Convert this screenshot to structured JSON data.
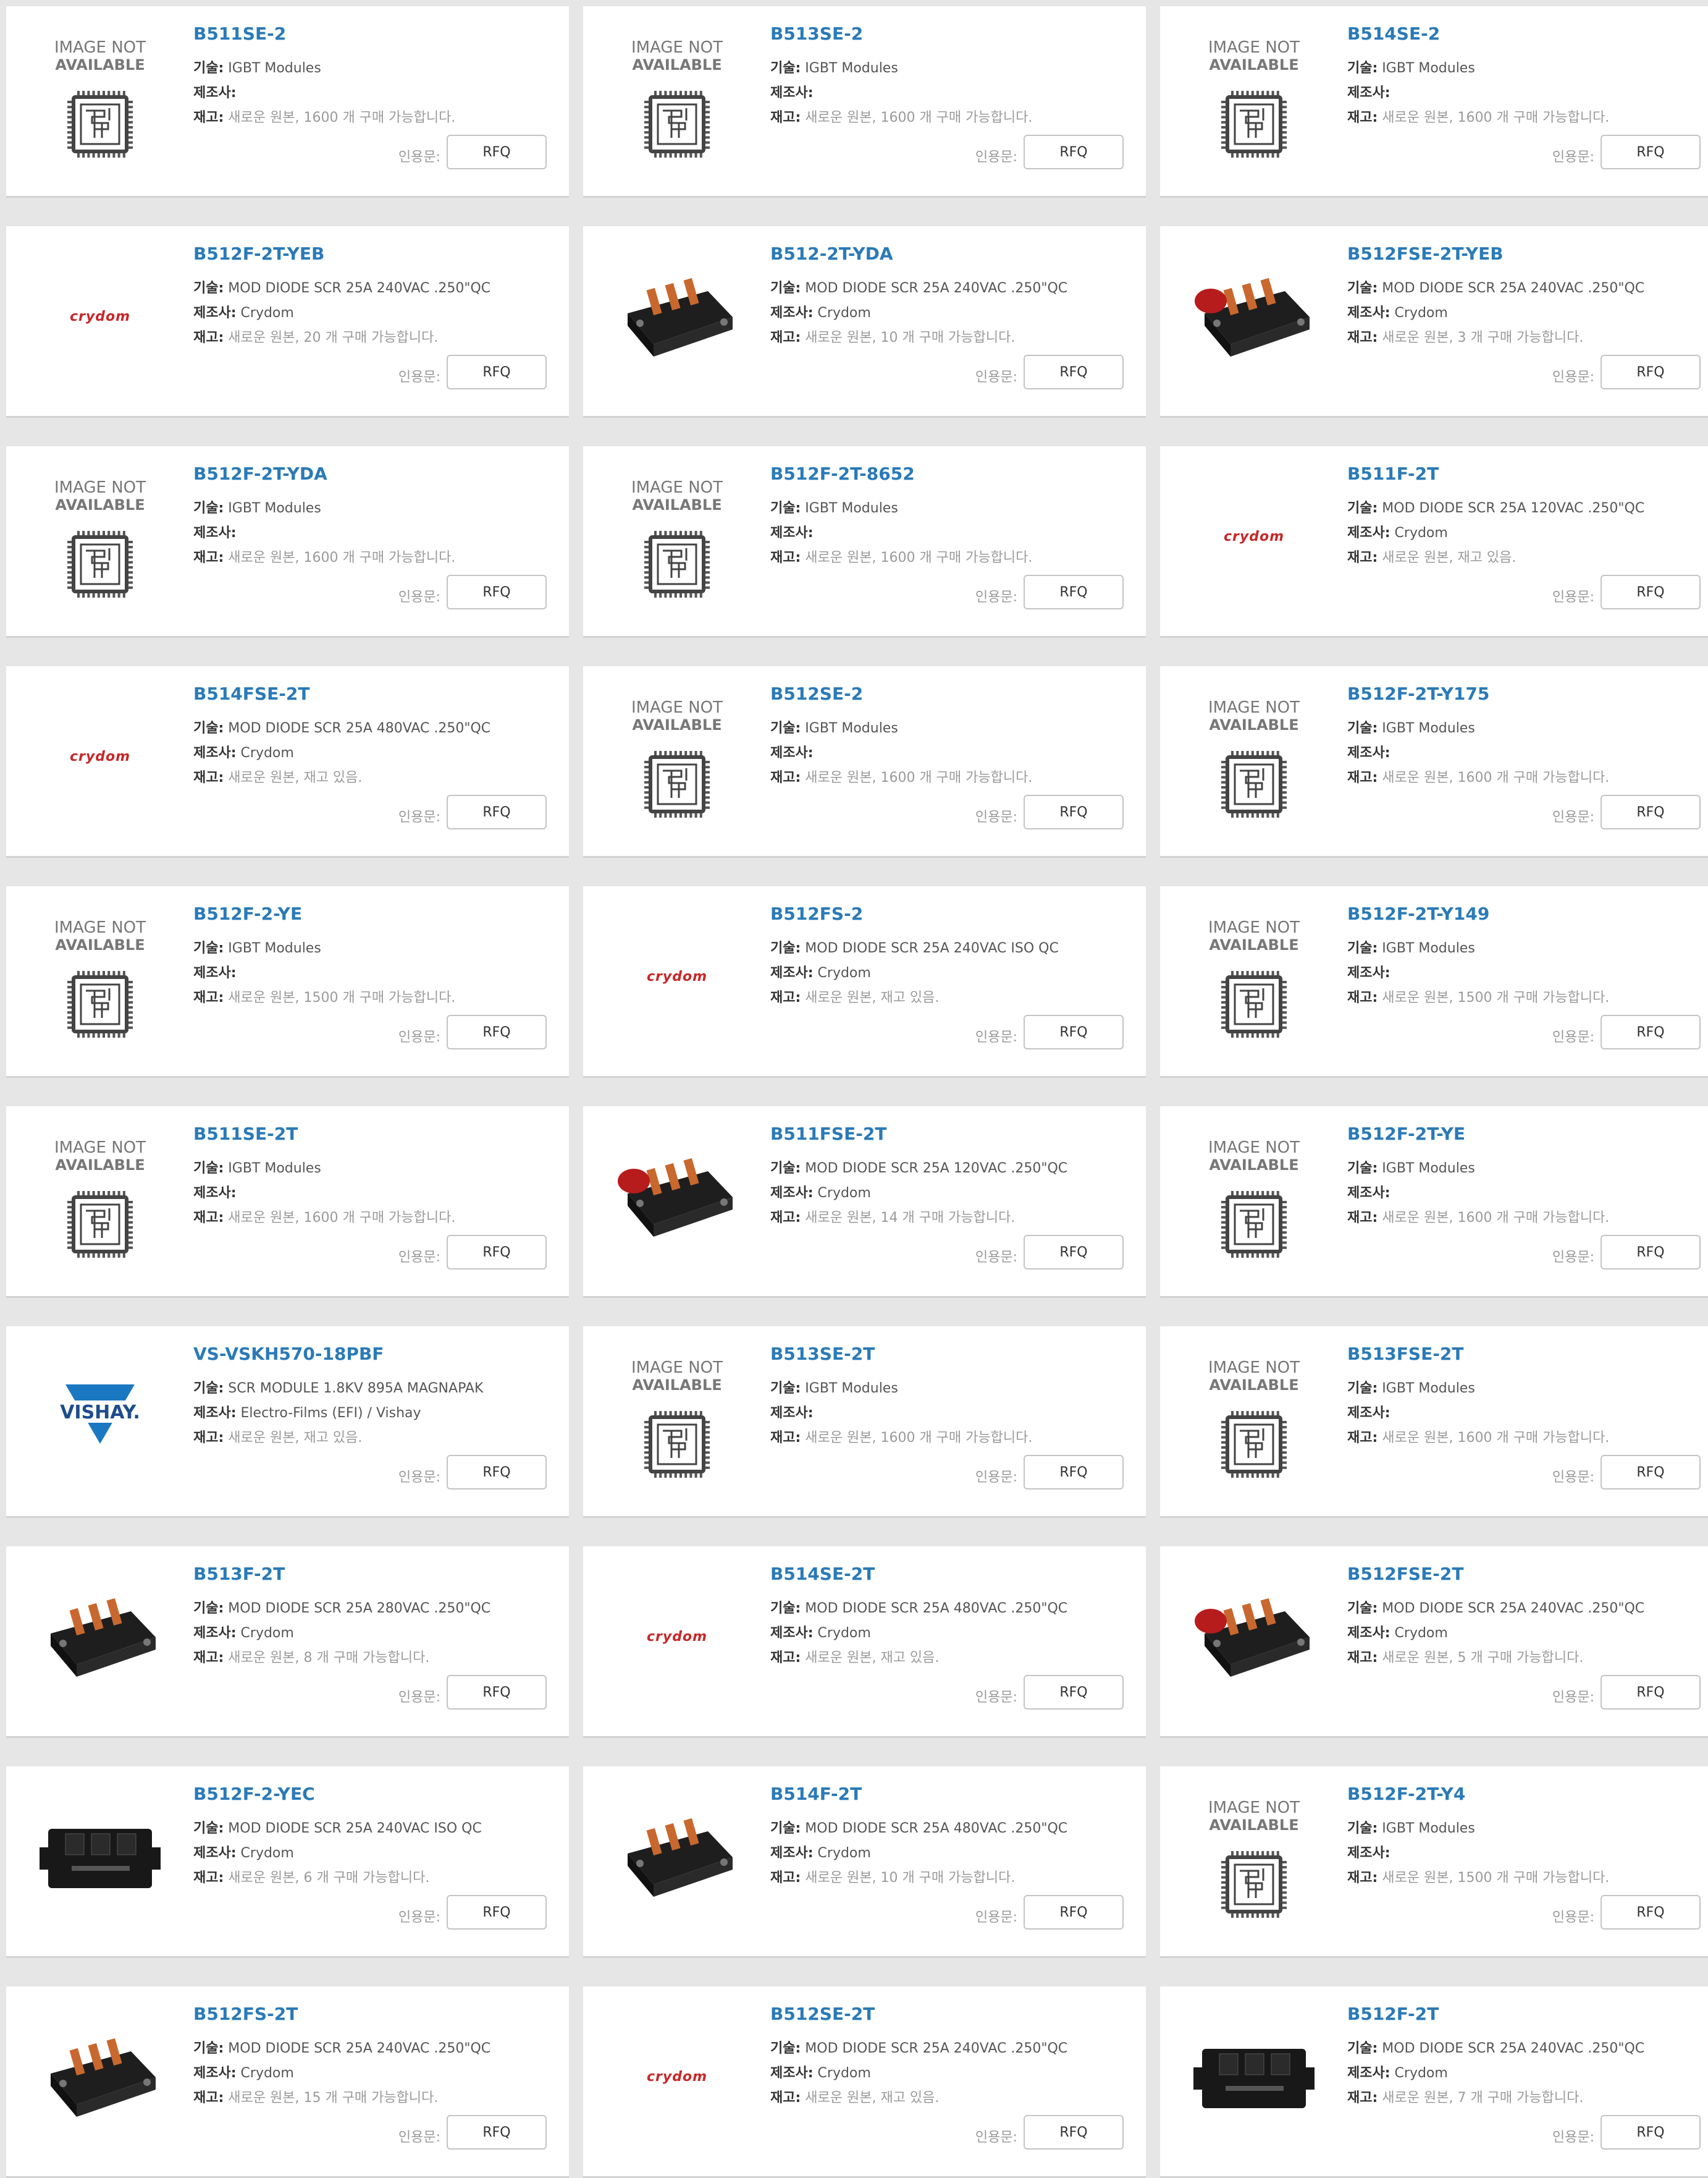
{
  "labels": {
    "tech": "기술:",
    "mfr": "제조사:",
    "stock": "재고:",
    "quote": "인용문:",
    "rfq": "RFQ",
    "na_line1": "IMAGE NOT",
    "na_line2": "AVAILABLE",
    "crydom": "crydom",
    "vishay": "VISHAY."
  },
  "colors": {
    "link": "#2a7ab8",
    "background": "#e6e6e6",
    "card": "#ffffff",
    "muted": "#9a9a9a"
  },
  "products": [
    {
      "part": "B511SE-2",
      "tech": "IGBT Modules",
      "mfr": "",
      "stock": "새로운 원본, 1600 개 구매 가능합니다.",
      "image": "image-not-available"
    },
    {
      "part": "B513SE-2",
      "tech": "IGBT Modules",
      "mfr": "",
      "stock": "새로운 원본, 1600 개 구매 가능합니다.",
      "image": "image-not-available"
    },
    {
      "part": "B514SE-2",
      "tech": "IGBT Modules",
      "mfr": "",
      "stock": "새로운 원본, 1600 개 구매 가능합니다.",
      "image": "image-not-available"
    },
    {
      "part": "B512F-2T-YEB",
      "tech": "MOD DIODE SCR 25A 240VAC .250\"QC",
      "mfr": "Crydom",
      "stock": "새로운 원본, 20 개 구매 가능합니다.",
      "image": "crydom-logo"
    },
    {
      "part": "B512-2T-YDA",
      "tech": "MOD DIODE SCR 25A 240VAC .250\"QC",
      "mfr": "Crydom",
      "stock": "새로운 원본, 10 개 구매 가능합니다.",
      "image": "scr-module"
    },
    {
      "part": "B512FSE-2T-YEB",
      "tech": "MOD DIODE SCR 25A 240VAC .250\"QC",
      "mfr": "Crydom",
      "stock": "새로운 원본, 3 개 구매 가능합니다.",
      "image": "scr-module-red"
    },
    {
      "part": "B512F-2T-YDA",
      "tech": "IGBT Modules",
      "mfr": "",
      "stock": "새로운 원본, 1600 개 구매 가능합니다.",
      "image": "image-not-available"
    },
    {
      "part": "B512F-2T-8652",
      "tech": "IGBT Modules",
      "mfr": "",
      "stock": "새로운 원본, 1600 개 구매 가능합니다.",
      "image": "image-not-available"
    },
    {
      "part": "B511F-2T",
      "tech": "MOD DIODE SCR 25A 120VAC .250\"QC",
      "mfr": "Crydom",
      "stock": "새로운 원본, 재고 있음.",
      "image": "crydom-logo"
    },
    {
      "part": "B514FSE-2T",
      "tech": "MOD DIODE SCR 25A 480VAC .250\"QC",
      "mfr": "Crydom",
      "stock": "새로운 원본, 재고 있음.",
      "image": "crydom-logo"
    },
    {
      "part": "B512SE-2",
      "tech": "IGBT Modules",
      "mfr": "",
      "stock": "새로운 원본, 1600 개 구매 가능합니다.",
      "image": "image-not-available"
    },
    {
      "part": "B512F-2T-Y175",
      "tech": "IGBT Modules",
      "mfr": "",
      "stock": "새로운 원본, 1600 개 구매 가능합니다.",
      "image": "image-not-available"
    },
    {
      "part": "B512F-2-YE",
      "tech": "IGBT Modules",
      "mfr": "",
      "stock": "새로운 원본, 1500 개 구매 가능합니다.",
      "image": "image-not-available"
    },
    {
      "part": "B512FS-2",
      "tech": "MOD DIODE SCR 25A 240VAC ISO QC",
      "mfr": "Crydom",
      "stock": "새로운 원본, 재고 있음.",
      "image": "crydom-logo"
    },
    {
      "part": "B512F-2T-Y149",
      "tech": "IGBT Modules",
      "mfr": "",
      "stock": "새로운 원본, 1500 개 구매 가능합니다.",
      "image": "image-not-available"
    },
    {
      "part": "B511SE-2T",
      "tech": "IGBT Modules",
      "mfr": "",
      "stock": "새로운 원본, 1600 개 구매 가능합니다.",
      "image": "image-not-available"
    },
    {
      "part": "B511FSE-2T",
      "tech": "MOD DIODE SCR 25A 120VAC .250\"QC",
      "mfr": "Crydom",
      "stock": "새로운 원본, 14 개 구매 가능합니다.",
      "image": "scr-module-red"
    },
    {
      "part": "B512F-2T-YE",
      "tech": "IGBT Modules",
      "mfr": "",
      "stock": "새로운 원본, 1600 개 구매 가능합니다.",
      "image": "image-not-available"
    },
    {
      "part": "VS-VSKH570-18PBF",
      "tech": "SCR MODULE 1.8KV 895A MAGNAPAK",
      "mfr": "Electro-Films (EFI) / Vishay",
      "stock": "새로운 원본, 재고 있음.",
      "image": "vishay-logo"
    },
    {
      "part": "B513SE-2T",
      "tech": "IGBT Modules",
      "mfr": "",
      "stock": "새로운 원본, 1600 개 구매 가능합니다.",
      "image": "image-not-available"
    },
    {
      "part": "B513FSE-2T",
      "tech": "IGBT Modules",
      "mfr": "",
      "stock": "새로운 원본, 1600 개 구매 가능합니다.",
      "image": "image-not-available"
    },
    {
      "part": "B513F-2T",
      "tech": "MOD DIODE SCR 25A 280VAC .250\"QC",
      "mfr": "Crydom",
      "stock": "새로운 원본, 8 개 구매 가능합니다.",
      "image": "scr-module"
    },
    {
      "part": "B514SE-2T",
      "tech": "MOD DIODE SCR 25A 480VAC .250\"QC",
      "mfr": "Crydom",
      "stock": "새로운 원본, 재고 있음.",
      "image": "crydom-logo"
    },
    {
      "part": "B512FSE-2T",
      "tech": "MOD DIODE SCR 25A 240VAC .250\"QC",
      "mfr": "Crydom",
      "stock": "새로운 원본, 5 개 구매 가능합니다.",
      "image": "scr-module-red"
    },
    {
      "part": "B512F-2-YEC",
      "tech": "MOD DIODE SCR 25A 240VAC ISO QC",
      "mfr": "Crydom",
      "stock": "새로운 원본, 6 개 구매 가능합니다.",
      "image": "scr-module-top"
    },
    {
      "part": "B514F-2T",
      "tech": "MOD DIODE SCR 25A 480VAC .250\"QC",
      "mfr": "Crydom",
      "stock": "새로운 원본, 10 개 구매 가능합니다.",
      "image": "scr-module"
    },
    {
      "part": "B512F-2T-Y4",
      "tech": "IGBT Modules",
      "mfr": "",
      "stock": "새로운 원본, 1500 개 구매 가능합니다.",
      "image": "image-not-available"
    },
    {
      "part": "B512FS-2T",
      "tech": "MOD DIODE SCR 25A 240VAC .250\"QC",
      "mfr": "Crydom",
      "stock": "새로운 원본, 15 개 구매 가능합니다.",
      "image": "scr-module"
    },
    {
      "part": "B512SE-2T",
      "tech": "MOD DIODE SCR 25A 240VAC .250\"QC",
      "mfr": "Crydom",
      "stock": "새로운 원본, 재고 있음.",
      "image": "crydom-logo"
    },
    {
      "part": "B512F-2T",
      "tech": "MOD DIODE SCR 25A 240VAC .250\"QC",
      "mfr": "Crydom",
      "stock": "새로운 원본, 7 개 구매 가능합니다.",
      "image": "scr-module-top"
    }
  ]
}
